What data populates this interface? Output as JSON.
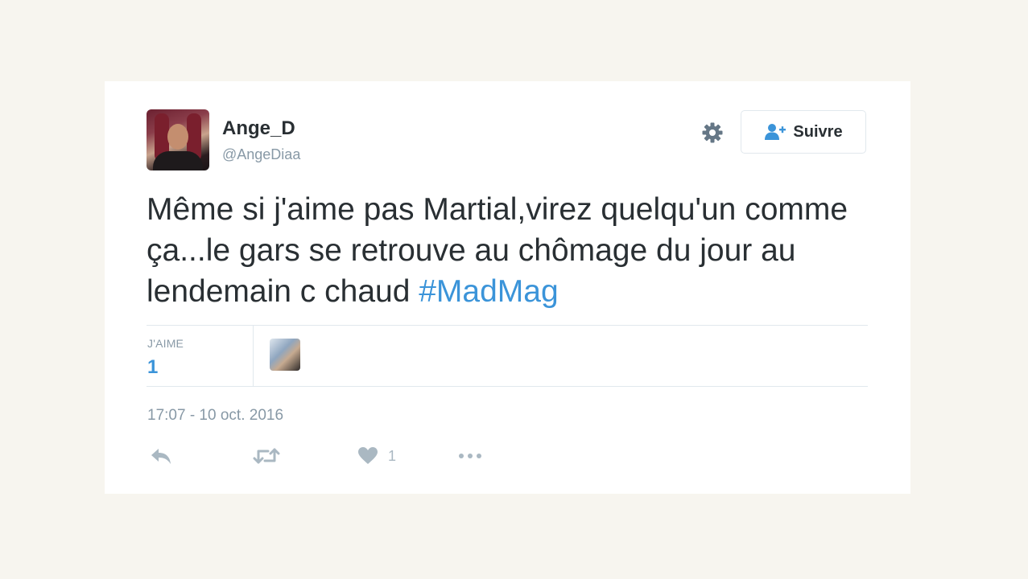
{
  "tweet": {
    "author": {
      "name": "Ange_D",
      "handle": "@AngeDiaa"
    },
    "follow_button": {
      "label": "Suivre",
      "icon": "add-user-icon"
    },
    "settings_icon": "gear-icon",
    "text": {
      "body": "Même si j'aime pas Martial,virez quelqu'un comme ça...le gars se retrouve au chômage du jour au lendemain c chaud ",
      "hashtag": "#MadMag"
    },
    "stats": {
      "likes_label": "J'AIME",
      "likes_count": "1"
    },
    "timestamp": "17:07 - 10 oct. 2016",
    "actions": {
      "reply_icon": "reply-icon",
      "retweet_icon": "retweet-icon",
      "like_icon": "heart-icon",
      "like_count": "1",
      "more_icon": "more-icon"
    },
    "colors": {
      "link": "#3b94d9",
      "text": "#292f33",
      "muted": "#8899a6",
      "action_icons": "#aab8c2",
      "background": "#f7f5ef"
    }
  }
}
